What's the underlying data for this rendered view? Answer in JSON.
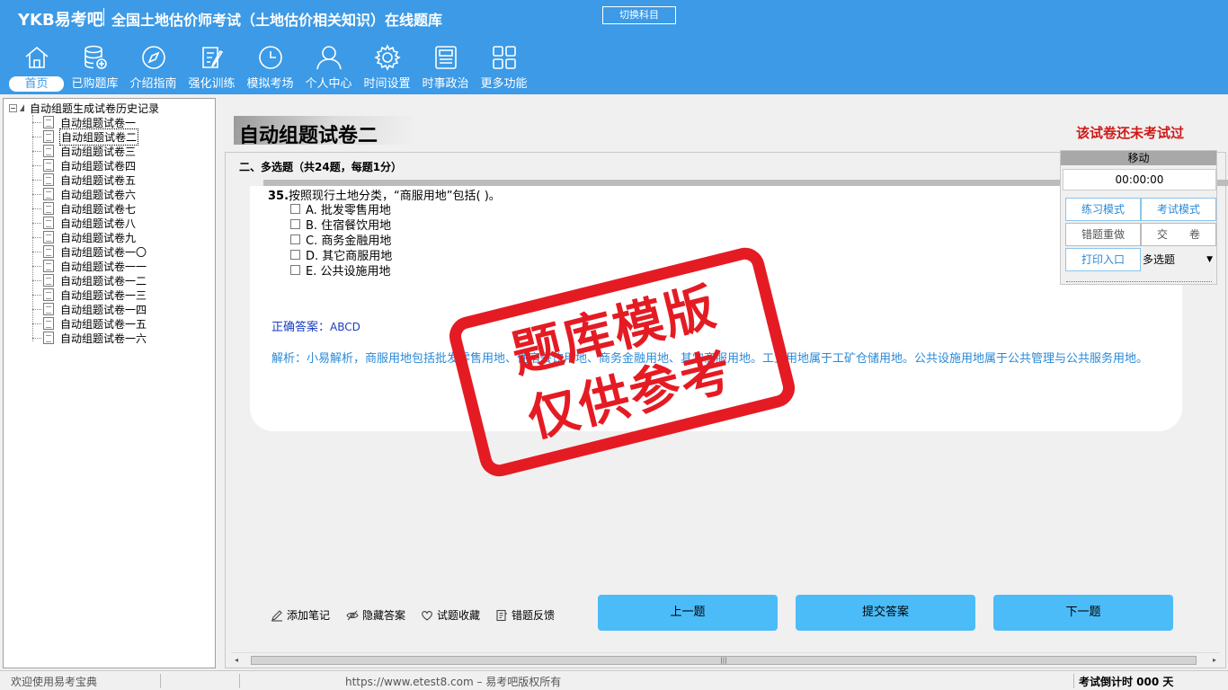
{
  "header": {
    "brand": "YKB易考吧",
    "app_title": "全国土地估价师考试（土地估价相关知识）在线题库",
    "switch_label": "切换科目"
  },
  "nav": {
    "items": [
      {
        "label": "首页",
        "icon": "home-icon"
      },
      {
        "label": "已购题库",
        "icon": "database-icon"
      },
      {
        "label": "介绍指南",
        "icon": "compass-icon"
      },
      {
        "label": "强化训练",
        "icon": "edit-icon"
      },
      {
        "label": "模拟考场",
        "icon": "clock-icon"
      },
      {
        "label": "个人中心",
        "icon": "user-icon"
      },
      {
        "label": "时间设置",
        "icon": "gear-icon"
      },
      {
        "label": "时事政治",
        "icon": "news-icon"
      },
      {
        "label": "更多功能",
        "icon": "grid-icon"
      }
    ]
  },
  "tree": {
    "root": "自动组题生成试卷历史记录",
    "items": [
      "自动组题试卷一",
      "自动组题试卷二",
      "自动组题试卷三",
      "自动组题试卷四",
      "自动组题试卷五",
      "自动组题试卷六",
      "自动组题试卷七",
      "自动组题试卷八",
      "自动组题试卷九",
      "自动组题试卷一〇",
      "自动组题试卷一一",
      "自动组题试卷一二",
      "自动组题试卷一三",
      "自动组题试卷一四",
      "自动组题试卷一五",
      "自动组题试卷一六"
    ],
    "selected": "自动组题试卷二"
  },
  "main": {
    "paper_title": "自动组题试卷二",
    "status_text": "该试卷还未考试过",
    "section_title": "二、多选题（共24题，每题1分）",
    "question": {
      "number": "35.",
      "text": "按照现行土地分类，“商服用地”包括( )。",
      "options": [
        "A. 批发零售用地",
        "B. 住宿餐饮用地",
        "C. 商务金融用地",
        "D. 其它商服用地",
        "E. 公共设施用地"
      ],
      "answer_label": "正确答案：",
      "answer_value": "ABCD",
      "analysis": "解析：小易解析，商服用地包括批发零售用地、住宿餐饮用地、商务金融用地、其它商服用地。工业用地属于工矿仓储用地。公共设施用地属于公共管理与公共服务用地。"
    },
    "tools": [
      "添加笔记",
      "隐藏答案",
      "试题收藏",
      "错题反馈"
    ],
    "buttons": {
      "prev": "上一题",
      "submit": "提交答案",
      "next": "下一题"
    }
  },
  "panel": {
    "head": "移动",
    "timer": "00:00:00",
    "practice_mode": "练习模式",
    "exam_mode": "考试模式",
    "redo_wrong": "错题重做",
    "hand_in": "交　　卷",
    "print": "打印入口",
    "type_select": "多选题"
  },
  "stamp": {
    "line1": "题库模版",
    "line2": "仅供参考"
  },
  "status": {
    "welcome": "欢迎使用易考宝典",
    "copyright": "https://www.etest8.com – 易考吧版权所有",
    "countdown": "考试倒计时 000 天"
  },
  "colors": {
    "header_bg": "#3c9ae6",
    "button_bg": "#4cbcf8",
    "stamp": "#e51b23",
    "status_red": "#d01818"
  }
}
